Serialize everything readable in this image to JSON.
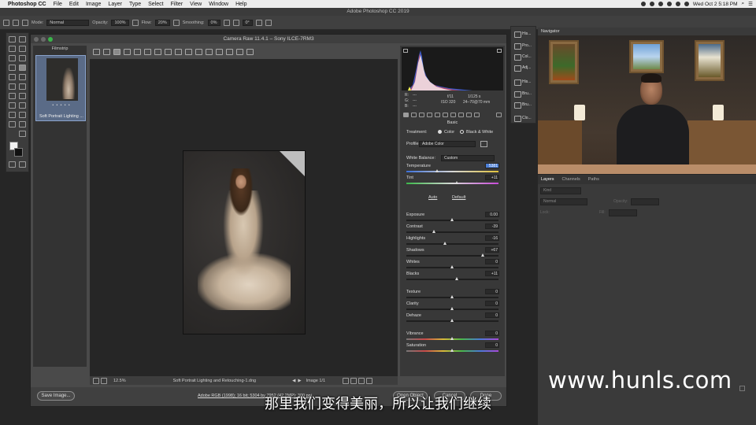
{
  "mac_menubar": {
    "app": "Photoshop CC",
    "items": [
      "File",
      "Edit",
      "Image",
      "Layer",
      "Type",
      "Select",
      "Filter",
      "View",
      "Window",
      "Help"
    ],
    "clock": "Wed Oct 2  5:18 PM"
  },
  "ps_title": "Adobe Photoshop CC 2019",
  "options_bar": {
    "mode_label": "Mode:",
    "mode_value": "Normal",
    "opacity_label": "Opacity:",
    "opacity_value": "100%",
    "flow_label": "Flow:",
    "flow_value": "20%",
    "smoothing_label": "Smoothing:",
    "smoothing_value": "0%",
    "angle_value": "0°"
  },
  "camera_raw": {
    "window_title": "Camera Raw 11.4.1  –  Sony ILCE-7RM3",
    "filmstrip_label": "Filmstrip",
    "thumb_stars": "• • • • •",
    "thumb_caption": "Soft Portrait Lighting ...",
    "zoom": "12.5%",
    "filename": "Soft Portrait Lighting and Retouching-1.dng",
    "image_counter": "Image 1/1",
    "workflow_link": "Adobe RGB (1998); 16 bit; 5304 by 7952 (42.2MP); 300 ppi",
    "buttons": {
      "save": "Save Image...",
      "open": "Open Object",
      "cancel": "Cancel",
      "done": "Done"
    },
    "readout": {
      "r": "R:",
      "g": "G:",
      "b": "B:",
      "dashes": "---",
      "aperture": "f/11",
      "shutter": "1/125 s",
      "iso": "ISO 320",
      "lens": "24–70@70 mm"
    },
    "basic": {
      "section_title": "Basic",
      "treatment_label": "Treatment:",
      "treatment_color": "Color",
      "treatment_bw": "Black & White",
      "profile_label": "Profile:",
      "profile_value": "Adobe Color",
      "wb_label": "White Balance:",
      "wb_value": "Custom",
      "auto": "Auto",
      "default": "Default"
    },
    "sliders": [
      {
        "label": "Temperature",
        "value": "5381",
        "pos": 0.34
      },
      {
        "label": "Tint",
        "value": "+11",
        "pos": 0.55
      },
      {
        "label": "Exposure",
        "value": "0.00",
        "pos": 0.5
      },
      {
        "label": "Contrast",
        "value": "-39",
        "pos": 0.3
      },
      {
        "label": "Highlights",
        "value": "-16",
        "pos": 0.42
      },
      {
        "label": "Shadows",
        "value": "+67",
        "pos": 0.83
      },
      {
        "label": "Whites",
        "value": "0",
        "pos": 0.5
      },
      {
        "label": "Blacks",
        "value": "+11",
        "pos": 0.55
      },
      {
        "label": "Texture",
        "value": "0",
        "pos": 0.5
      },
      {
        "label": "Clarity",
        "value": "0",
        "pos": 0.5
      },
      {
        "label": "Dehaze",
        "value": "0",
        "pos": 0.5
      },
      {
        "label": "Vibrance",
        "value": "0",
        "pos": 0.5
      },
      {
        "label": "Saturation",
        "value": "0",
        "pos": 0.5
      }
    ]
  },
  "mini_panels": [
    "His...",
    "Pro...",
    "Col...",
    "Adj...",
    "His...",
    "Bru...",
    "Bru...",
    "Clo..."
  ],
  "navigator_label": "Navigator",
  "layers": {
    "tabs": [
      "Layers",
      "Channels",
      "Paths"
    ],
    "kind_placeholder": "Kind",
    "blend_mode": "Normal",
    "opacity_label": "Opacity:",
    "lock_label": "Lock:",
    "fill_label": "Fill:"
  },
  "watermark": "www.hunls.com",
  "subtitle": "那里我们变得美丽，所以让我们继续",
  "colors": {
    "accent_blue": "#4c7fd6",
    "panel_bg": "#383838"
  }
}
